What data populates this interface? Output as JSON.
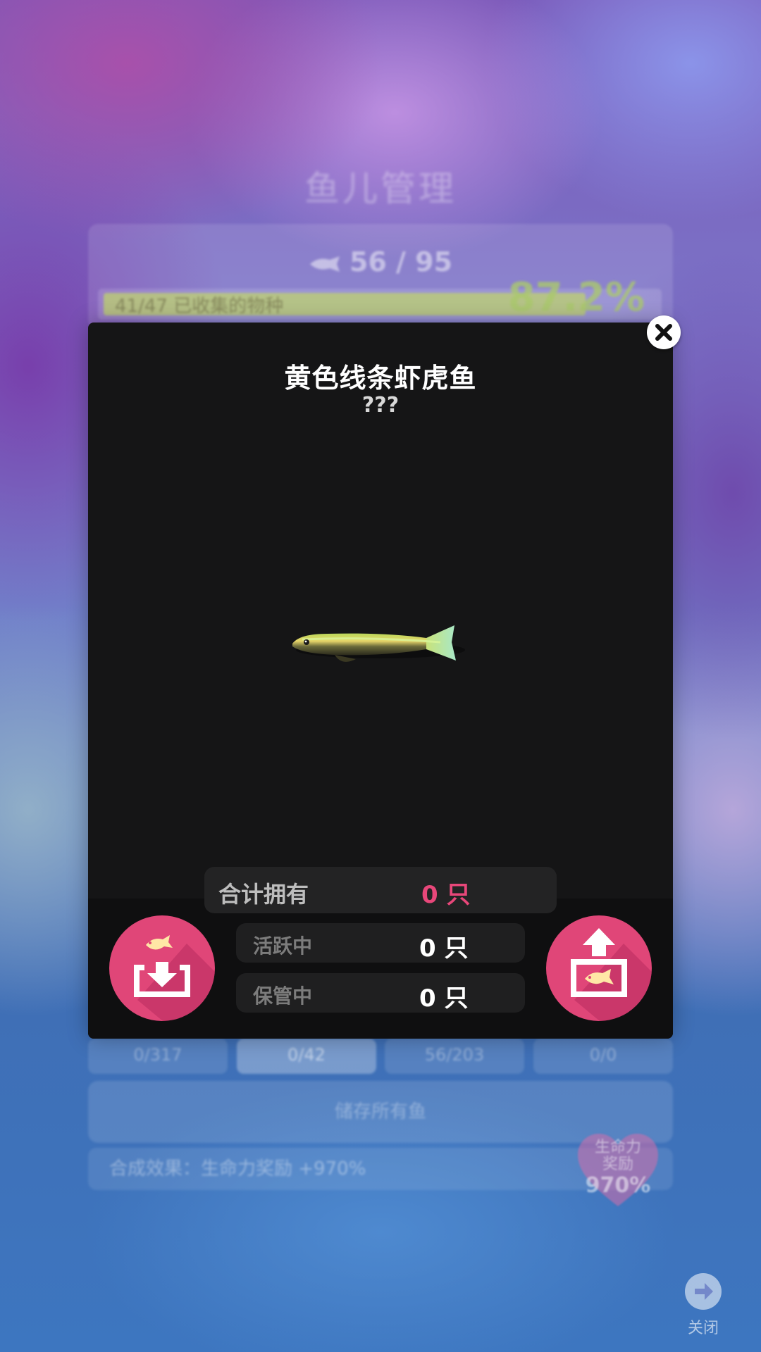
{
  "background": {
    "page_title": "鱼儿管理",
    "fish_count": "56 / 95",
    "species_progress_text": "41/47 已收集的物种",
    "species_progress_fraction": 0.872,
    "species_percent": "87.2%",
    "tabs": [
      "0/317",
      "0/42",
      "56/203",
      "0/0"
    ],
    "active_tab_index": 1,
    "store_all_label": "储存所有鱼",
    "synthesis_effect": "合成效果：生命力奖励 +970%",
    "vitality_badge_label": "生命力\n奖励",
    "vitality_badge_line1": "生命力",
    "vitality_badge_line2": "奖励",
    "vitality_badge_value": "970%",
    "close_label": "关闭"
  },
  "modal": {
    "fish_name": "黄色线条虾虎鱼",
    "fish_subtitle": "???",
    "total_label": "合计拥有",
    "total_value": "0 只",
    "active_label": "活跃中",
    "active_value": "0 只",
    "stored_label": "保管中",
    "stored_value": "0 只"
  },
  "colors": {
    "accent_pink": "#e04678",
    "total_value_color": "#e8477a",
    "modal_bg": "#151516"
  }
}
